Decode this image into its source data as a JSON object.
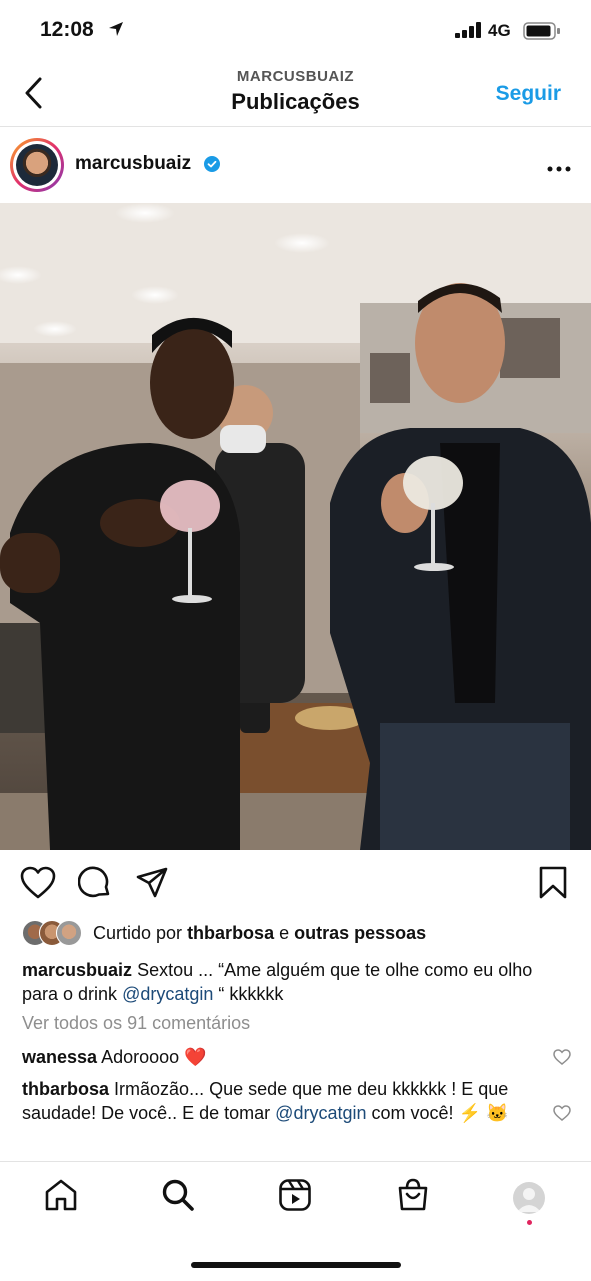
{
  "status_bar": {
    "time": "12:08",
    "network": "4G"
  },
  "header": {
    "username_caps": "MARCUSBUAIZ",
    "title": "Publicações",
    "follow_label": "Seguir"
  },
  "post": {
    "username": "marcusbuaiz",
    "liked_prefix": "Curtido por",
    "liked_user": "thbarbosa",
    "liked_connector": "e",
    "liked_others": "outras pessoas",
    "caption_user": "marcusbuaiz",
    "caption_text_1": "Sextou ... “Ame alguém que te olhe como eu olho para o drink",
    "caption_mention": "@drycatgin",
    "caption_text_2": "“ kkkkkk",
    "view_all_comments": "Ver todos os 91 comentários",
    "comments": [
      {
        "user": "wanessa",
        "text": "Adoroooo ❤️"
      },
      {
        "user": "thbarbosa",
        "text_1": "Irmãozão... Que sede que me deu kkkkkk ! E que saudade! De você.. E de tomar",
        "mention": "@drycatgin",
        "text_2": "com você! ⚡ 🐱"
      }
    ]
  },
  "icons": {
    "status": [
      "location-arrow-icon",
      "signal-icon",
      "battery-icon"
    ],
    "header": [
      "back-chevron-icon"
    ],
    "post": [
      "verified-badge-icon",
      "more-options-icon",
      "like-heart-icon",
      "comment-icon",
      "share-icon",
      "bookmark-icon",
      "comment-like-icon"
    ],
    "tabbar": [
      "home-icon",
      "search-icon",
      "reels-icon",
      "shop-icon",
      "profile-avatar"
    ]
  },
  "colors": {
    "accent": "#1a9be6",
    "mention": "#1c4a78",
    "heart_red": "#e0245e",
    "muted": "#8e8e8e"
  }
}
